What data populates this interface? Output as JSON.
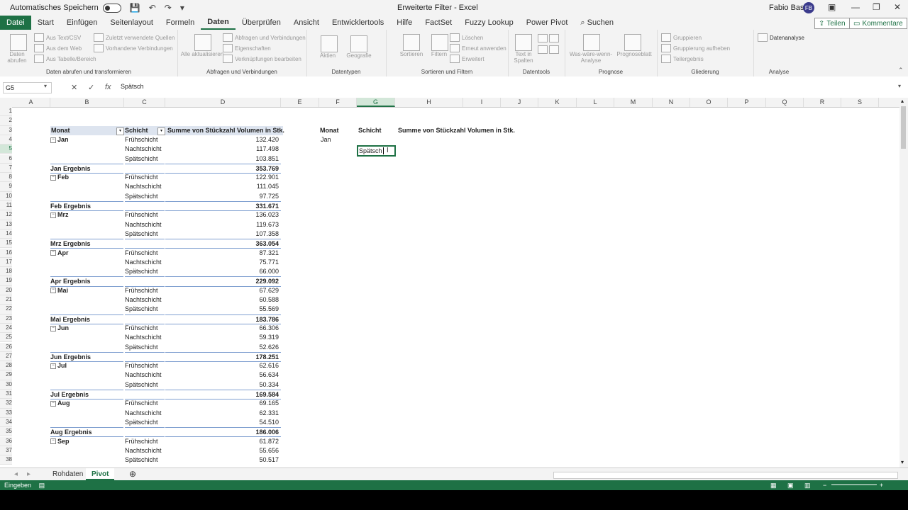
{
  "titlebar": {
    "autosave_label": "Automatisches Speichern",
    "doc_title": "Erweiterte Filter - Excel",
    "user_name": "Fabio Basler",
    "user_initials": "FB"
  },
  "menu": {
    "tabs": [
      "Datei",
      "Start",
      "Einfügen",
      "Seitenlayout",
      "Formeln",
      "Daten",
      "Überprüfen",
      "Ansicht",
      "Entwicklertools",
      "Hilfe",
      "FactSet",
      "Fuzzy Lookup",
      "Power Pivot"
    ],
    "search": "Suchen",
    "share": "Teilen",
    "comments": "Kommentare"
  },
  "ribbon": {
    "g1": {
      "label": "Daten abrufen und transformieren",
      "big": "Daten abrufen",
      "items": [
        "Aus Text/CSV",
        "Aus dem Web",
        "Aus Tabelle/Bereich",
        "Zuletzt verwendete Quellen",
        "Vorhandene Verbindungen"
      ]
    },
    "g2": {
      "label": "Abfragen und Verbindungen",
      "big": "Alle aktualisieren",
      "items": [
        "Abfragen und Verbindungen",
        "Eigenschaften",
        "Verknüpfungen bearbeiten"
      ]
    },
    "g3": {
      "label": "Datentypen",
      "items": [
        "Aktien",
        "Geografie"
      ]
    },
    "g4": {
      "label": "Sortieren und Filtern",
      "items": [
        "Sortieren",
        "Filtern",
        "Löschen",
        "Erneut anwenden",
        "Erweitert"
      ]
    },
    "g5": {
      "label": "Datentools",
      "big": "Text in Spalten"
    },
    "g6": {
      "label": "Prognose",
      "items": [
        "Was-wäre-wenn-Analyse",
        "Prognoseblatt"
      ]
    },
    "g7": {
      "label": "Gliederung",
      "items": [
        "Gruppieren",
        "Gruppierung aufheben",
        "Teilergebnis"
      ]
    },
    "g8": {
      "label": "Analyse",
      "items": [
        "Datenanalyse"
      ]
    }
  },
  "formulabar": {
    "namebox": "G5",
    "formula": "Spätsch"
  },
  "columns": [
    "A",
    "B",
    "C",
    "D",
    "E",
    "F",
    "G",
    "H",
    "I",
    "J",
    "K",
    "L",
    "M",
    "N",
    "O",
    "P",
    "Q",
    "R",
    "S"
  ],
  "pivot": {
    "headers": [
      "Monat",
      "Schicht",
      "Summe von Stückzahl Volumen in Stk."
    ],
    "rows": [
      {
        "r": 4,
        "b": "Jan",
        "c": "Frühschicht",
        "d": "132.420",
        "type": "first"
      },
      {
        "r": 5,
        "b": "",
        "c": "Nachtschicht",
        "d": "117.498",
        "type": "item"
      },
      {
        "r": 6,
        "b": "",
        "c": "Spätschicht",
        "d": "103.851",
        "type": "item"
      },
      {
        "r": 7,
        "b": "Jan Ergebnis",
        "c": "",
        "d": "353.769",
        "type": "sub"
      },
      {
        "r": 8,
        "b": "Feb",
        "c": "Frühschicht",
        "d": "122.901",
        "type": "first"
      },
      {
        "r": 9,
        "b": "",
        "c": "Nachtschicht",
        "d": "111.045",
        "type": "item"
      },
      {
        "r": 10,
        "b": "",
        "c": "Spätschicht",
        "d": "97.725",
        "type": "item"
      },
      {
        "r": 11,
        "b": "Feb Ergebnis",
        "c": "",
        "d": "331.671",
        "type": "sub"
      },
      {
        "r": 12,
        "b": "Mrz",
        "c": "Frühschicht",
        "d": "136.023",
        "type": "first"
      },
      {
        "r": 13,
        "b": "",
        "c": "Nachtschicht",
        "d": "119.673",
        "type": "item"
      },
      {
        "r": 14,
        "b": "",
        "c": "Spätschicht",
        "d": "107.358",
        "type": "item"
      },
      {
        "r": 15,
        "b": "Mrz Ergebnis",
        "c": "",
        "d": "363.054",
        "type": "sub"
      },
      {
        "r": 16,
        "b": "Apr",
        "c": "Frühschicht",
        "d": "87.321",
        "type": "first"
      },
      {
        "r": 17,
        "b": "",
        "c": "Nachtschicht",
        "d": "75.771",
        "type": "item"
      },
      {
        "r": 18,
        "b": "",
        "c": "Spätschicht",
        "d": "66.000",
        "type": "item"
      },
      {
        "r": 19,
        "b": "Apr Ergebnis",
        "c": "",
        "d": "229.092",
        "type": "sub"
      },
      {
        "r": 20,
        "b": "Mai",
        "c": "Frühschicht",
        "d": "67.629",
        "type": "first"
      },
      {
        "r": 21,
        "b": "",
        "c": "Nachtschicht",
        "d": "60.588",
        "type": "item"
      },
      {
        "r": 22,
        "b": "",
        "c": "Spätschicht",
        "d": "55.569",
        "type": "item"
      },
      {
        "r": 23,
        "b": "Mai Ergebnis",
        "c": "",
        "d": "183.786",
        "type": "sub"
      },
      {
        "r": 24,
        "b": "Jun",
        "c": "Frühschicht",
        "d": "66.306",
        "type": "first"
      },
      {
        "r": 25,
        "b": "",
        "c": "Nachtschicht",
        "d": "59.319",
        "type": "item"
      },
      {
        "r": 26,
        "b": "",
        "c": "Spätschicht",
        "d": "52.626",
        "type": "item"
      },
      {
        "r": 27,
        "b": "Jun Ergebnis",
        "c": "",
        "d": "178.251",
        "type": "sub"
      },
      {
        "r": 28,
        "b": "Jul",
        "c": "Frühschicht",
        "d": "62.616",
        "type": "first"
      },
      {
        "r": 29,
        "b": "",
        "c": "Nachtschicht",
        "d": "56.634",
        "type": "item"
      },
      {
        "r": 30,
        "b": "",
        "c": "Spätschicht",
        "d": "50.334",
        "type": "item"
      },
      {
        "r": 31,
        "b": "Jul Ergebnis",
        "c": "",
        "d": "169.584",
        "type": "sub"
      },
      {
        "r": 32,
        "b": "Aug",
        "c": "Frühschicht",
        "d": "69.165",
        "type": "first"
      },
      {
        "r": 33,
        "b": "",
        "c": "Nachtschicht",
        "d": "62.331",
        "type": "item"
      },
      {
        "r": 34,
        "b": "",
        "c": "Spätschicht",
        "d": "54.510",
        "type": "item"
      },
      {
        "r": 35,
        "b": "Aug Ergebnis",
        "c": "",
        "d": "186.006",
        "type": "sub"
      },
      {
        "r": 36,
        "b": "Sep",
        "c": "Frühschicht",
        "d": "61.872",
        "type": "first"
      },
      {
        "r": 37,
        "b": "",
        "c": "Nachtschicht",
        "d": "55.656",
        "type": "item"
      },
      {
        "r": 38,
        "b": "",
        "c": "Spätschicht",
        "d": "50.517",
        "type": "item"
      }
    ]
  },
  "criteria": {
    "headers": [
      "Monat",
      "Schicht",
      "Summe von Stückzahl Volumen in Stk."
    ],
    "f4": "Jan",
    "g5": "Spätsch"
  },
  "sheets": [
    "Rohdaten",
    "Pivot"
  ],
  "status": "Eingeben",
  "colors": {
    "accent": "#1e7145",
    "pivot_header": "#dde4ef"
  }
}
